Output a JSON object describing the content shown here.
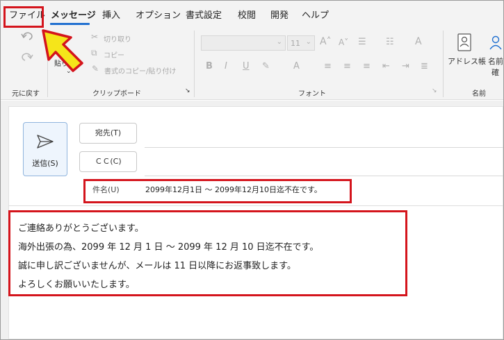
{
  "menu": {
    "tabs": [
      "ファイル",
      "メッセージ",
      "挿入",
      "オプション",
      "書式設定",
      "校閲",
      "開発",
      "ヘルプ"
    ]
  },
  "ribbon": {
    "undo_label": "元に戻す",
    "paste_label": "貼り付け",
    "cut_label": "切り取り",
    "copy_label": "コピー",
    "format_painter_label": "書式のコピー/貼り付け",
    "clipboard_group": "クリップボード",
    "font_size": "11",
    "font_group": "フォント",
    "address_book_label": "アドレス帳",
    "check_names_label_line1": "名前",
    "check_names_label_line2": "確",
    "names_group": "名前"
  },
  "compose": {
    "send_label": "送信(S)",
    "to_label": "宛先(T)",
    "cc_label": "ＣＣ(C)",
    "subject_label": "件名(U)",
    "subject_value": "2099年12月1日 ～ 2099年12月10日迄不在です。",
    "body_lines": [
      "ご連絡ありがとうございます。",
      "海外出張の為、2099 年 12 月 1 日 ～ 2099 年 12 月 10 日迄不在です。",
      "誠に申し訳ございませんが、メールは 11 日以降にお返事致します。",
      "よろしくお願いいたします。"
    ]
  },
  "colors": {
    "highlight": "#d4141c",
    "accent": "#1f6fd0",
    "arrow_fill": "#f5e51a"
  }
}
